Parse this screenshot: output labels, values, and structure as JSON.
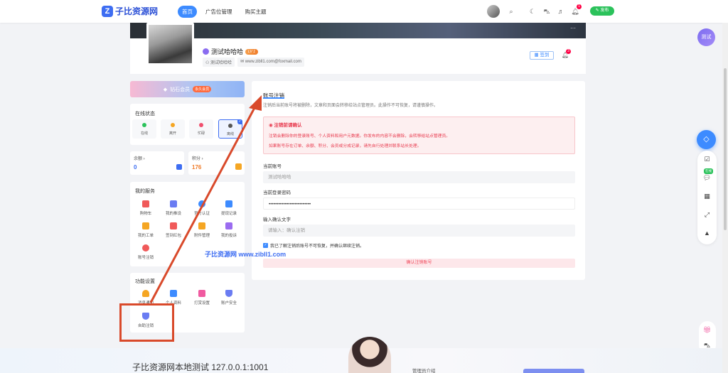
{
  "nav": {
    "logo_mark": "Z",
    "logo_text": "子比资源网",
    "links": [
      "首页",
      "广告位管理",
      "购买主题"
    ],
    "publish_label": "✎ 发布",
    "notify_count": "1"
  },
  "float_test_label": "测试",
  "profile": {
    "name": "测试哈哈哈",
    "level": "LV 1",
    "username": "测试哈哈哈",
    "email": "www.zibll1.com@foxmail.com",
    "signin_label": "签到",
    "bell_count": "3",
    "more": "···"
  },
  "vip": {
    "label": "钻石会员",
    "badge": "永久会员"
  },
  "online": {
    "title": "在线状态",
    "items": [
      {
        "label": "在线",
        "color": "#2bc25b"
      },
      {
        "label": "离开",
        "color": "#f5a623"
      },
      {
        "label": "忙碌",
        "color": "#f0506e"
      },
      {
        "label": "离线",
        "color": "#555555"
      }
    ]
  },
  "stats": [
    {
      "label": "余额 ›",
      "value": "0",
      "value_color": "#3d6df2"
    },
    {
      "label": "积分 ›",
      "value": "176",
      "value_color": "#f07c2a"
    }
  ],
  "services": {
    "title": "我的服务",
    "items": [
      "购物车",
      "我的推设",
      "官方认证",
      "提现记录",
      "我的工单",
      "签到红包",
      "附件管理",
      "我的投诉",
      "账号注销"
    ]
  },
  "settings": {
    "title": "功能设置",
    "items": [
      "消息通知",
      "个人资料",
      "打赏设置",
      "账户安全",
      "自助注销"
    ]
  },
  "panel": {
    "title": "账号注销",
    "desc": "注销后当前账号将被删除，文章和页面会转移给站点管理员。此操作不可恢复，请谨慎操作。",
    "warn_title": "注销前请确认",
    "warn_lines": [
      "注销会删除你的登录账号、个人资料和用户元数据。你发布的内容不会删除，会转移给站点管理员。",
      "如果账号存在订单、余额、积分、会员或分成记录，请先自行处理并联系站长处理。"
    ],
    "current_account_label": "当前账号",
    "current_account_value": "测试哈哈哈",
    "password_label": "当前登录密码",
    "password_value": "••••••••••••••••••••••••••",
    "confirm_label": "输入确认文字",
    "confirm_placeholder": "请输入：确认注销",
    "checkbox_label": "我已了解注销后账号不可恢复，并确认继续注销。",
    "submit_label": "确认注销账号"
  },
  "watermark": "子比资源网 www.zibll1.com",
  "footer": {
    "title": "子比资源网本地测试 127.0.0.1:1001",
    "admin": "管理员介绍"
  },
  "float_badge": "在线",
  "colors": {
    "accent": "#3d8bff",
    "annotation": "#d94a2b"
  }
}
